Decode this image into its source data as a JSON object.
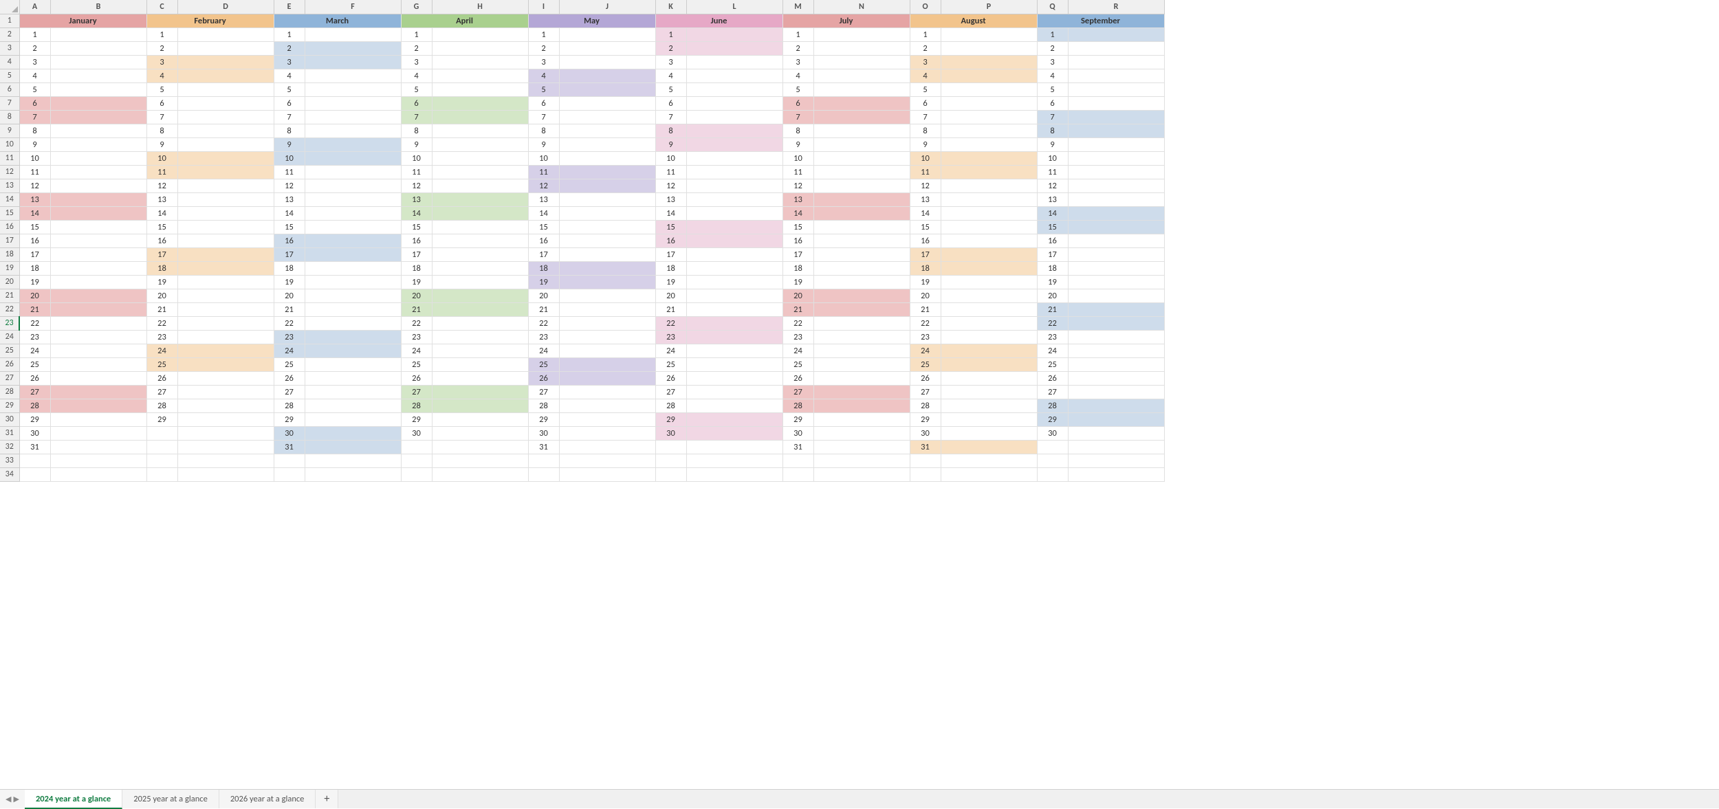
{
  "columns": [
    "A",
    "B",
    "C",
    "D",
    "E",
    "F",
    "G",
    "H",
    "I",
    "J",
    "K",
    "L",
    "M",
    "N",
    "O",
    "P",
    "Q",
    "R"
  ],
  "rows_visible": 34,
  "active_row": 23,
  "months": [
    {
      "name": "January",
      "color": "#e5a4a4",
      "dayColor": "#efc4c4",
      "days": 31,
      "firstWeekday": 0,
      "cols": [
        "A",
        "B"
      ]
    },
    {
      "name": "February",
      "color": "#f2c48c",
      "dayColor": "#f8e0c2",
      "days": 29,
      "firstWeekday": 3,
      "cols": [
        "C",
        "D"
      ]
    },
    {
      "name": "March",
      "color": "#8fb4d9",
      "dayColor": "#cedceb",
      "days": 31,
      "firstWeekday": 4,
      "cols": [
        "E",
        "F"
      ]
    },
    {
      "name": "April",
      "color": "#a9d08e",
      "dayColor": "#d4e7c7",
      "days": 30,
      "firstWeekday": 0,
      "cols": [
        "G",
        "H"
      ]
    },
    {
      "name": "May",
      "color": "#b4a7d6",
      "dayColor": "#d6d0e8",
      "days": 31,
      "firstWeekday": 2,
      "cols": [
        "I",
        "J"
      ]
    },
    {
      "name": "June",
      "color": "#e6a8c6",
      "dayColor": "#f1d7e4",
      "days": 30,
      "firstWeekday": 5,
      "cols": [
        "K",
        "L"
      ]
    },
    {
      "name": "July",
      "color": "#e5a4a4",
      "dayColor": "#efc4c4",
      "days": 31,
      "firstWeekday": 0,
      "cols": [
        "M",
        "N"
      ]
    },
    {
      "name": "August",
      "color": "#f2c48c",
      "dayColor": "#f8e0c2",
      "days": 31,
      "firstWeekday": 3,
      "cols": [
        "O",
        "P"
      ]
    },
    {
      "name": "September",
      "color": "#8fb4d9",
      "dayColor": "#cedceb",
      "days": 30,
      "firstWeekday": 6,
      "cols": [
        "Q",
        "R"
      ]
    }
  ],
  "sheet_tabs": [
    {
      "label": "2024 year at a glance",
      "active": true
    },
    {
      "label": "2025 year at a glance",
      "active": false
    },
    {
      "label": "2026 year at a glance",
      "active": false
    }
  ],
  "add_tab_label": "+"
}
